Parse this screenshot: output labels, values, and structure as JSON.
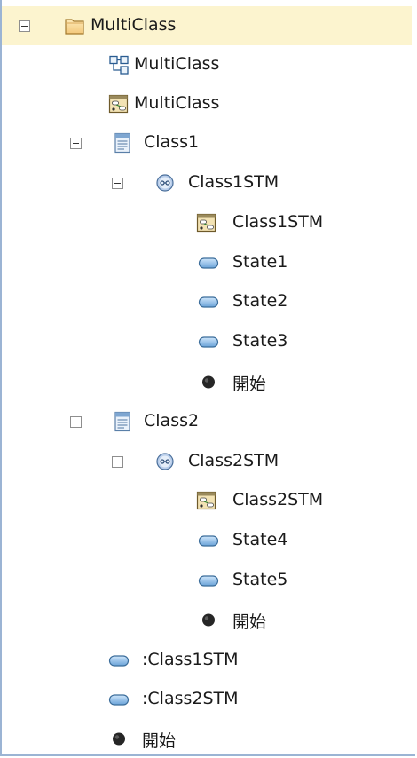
{
  "tree": {
    "root_label": "MultiClass",
    "diagram_label": "MultiClass",
    "package_diagram_label": "MultiClass",
    "class1": {
      "label": "Class1",
      "stm": {
        "label": "Class1STM",
        "diagram_label": "Class1STM",
        "states": [
          "State1",
          "State2",
          "State3"
        ],
        "initial_label": "開始"
      }
    },
    "class2": {
      "label": "Class2",
      "stm": {
        "label": "Class2STM",
        "diagram_label": "Class2STM",
        "states": [
          "State4",
          "State5"
        ],
        "initial_label": "開始"
      }
    },
    "instances": [
      ":Class1STM",
      ":Class2STM"
    ],
    "initial_label": "開始"
  },
  "colors": {
    "selection": "#fcf4cf",
    "state_fill": "#7fb2e0",
    "border": "#9bb4d4"
  }
}
